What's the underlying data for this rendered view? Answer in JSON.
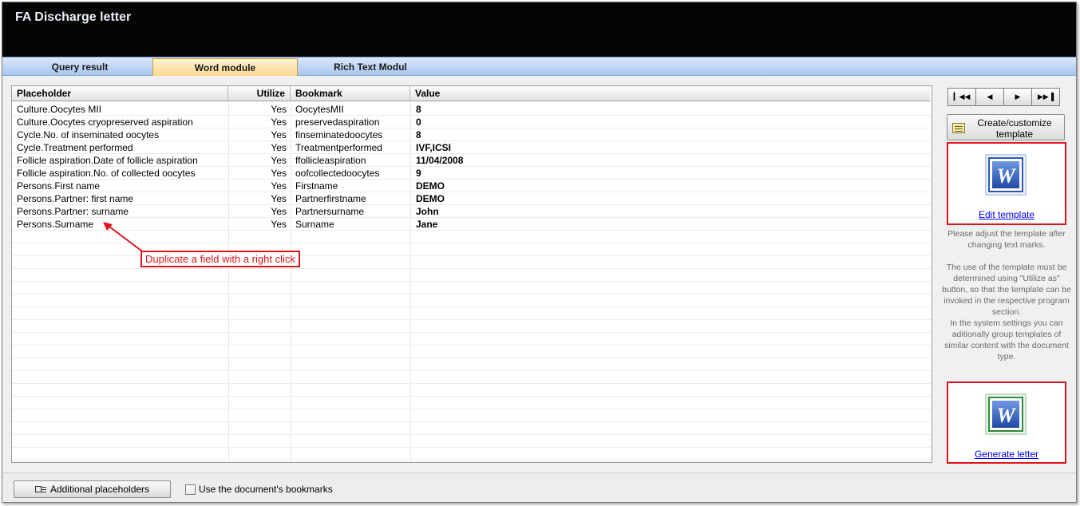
{
  "window": {
    "title": "FA Discharge letter"
  },
  "tabs": [
    {
      "label": "Query result"
    },
    {
      "label": "Word module"
    },
    {
      "label": "Rich Text Modul"
    }
  ],
  "active_tab": "Word module",
  "grid": {
    "columns": [
      "Placeholder",
      "Utilize",
      "Bookmark",
      "Value"
    ],
    "rows": [
      {
        "placeholder": "Culture.Oocytes MII",
        "utilize": "Yes",
        "bookmark": "OocytesMII",
        "value": "8"
      },
      {
        "placeholder": "Culture.Oocytes cryopreserved  aspiration",
        "utilize": "Yes",
        "bookmark": "preservedaspiration",
        "value": "0"
      },
      {
        "placeholder": "Cycle.No. of inseminated oocytes",
        "utilize": "Yes",
        "bookmark": "finseminatedoocytes",
        "value": "8"
      },
      {
        "placeholder": "Cycle.Treatment performed",
        "utilize": "Yes",
        "bookmark": "Treatmentperformed",
        "value": "IVF,ICSI"
      },
      {
        "placeholder": "Follicle aspiration.Date of follicle aspiration",
        "utilize": "Yes",
        "bookmark": "ffollicleaspiration",
        "value": "11/04/2008"
      },
      {
        "placeholder": "Follicle aspiration.No. of collected oocytes",
        "utilize": "Yes",
        "bookmark": "oofcollectedoocytes",
        "value": "9"
      },
      {
        "placeholder": "Persons.First name",
        "utilize": "Yes",
        "bookmark": "Firstname",
        "value": "DEMO"
      },
      {
        "placeholder": "Persons.Partner: first name",
        "utilize": "Yes",
        "bookmark": "Partnerfirstname",
        "value": "DEMO"
      },
      {
        "placeholder": "Persons.Partner: surname",
        "utilize": "Yes",
        "bookmark": "Partnersurname",
        "value": "John"
      },
      {
        "placeholder": "Persons.Surname",
        "utilize": "Yes",
        "bookmark": "Surname",
        "value": "Jane"
      }
    ]
  },
  "annotation": {
    "text": "Duplicate a field with a right click",
    "color": "#e0141a"
  },
  "navigation": {
    "first_icon": "first-record-icon",
    "prev_icon": "previous-record-icon",
    "next_icon": "next-record-icon",
    "last_icon": "last-record-icon"
  },
  "side_panel": {
    "create_button": "Create/customize template",
    "edit_link": "Edit template",
    "help_text": "Please adjust the template after changing text marks.\n\nThe use of the template must be determined using \"Utilize as\" button, so that the template can be invoked in the respective program section.\nIn the system settings you can aditionally group templates of similar content with the document type.",
    "generate_link": "Generate letter",
    "word_icon": "microsoft-word-icon"
  },
  "bottom": {
    "additional_button": "Additional placeholders",
    "bookmarks_checkbox_label": "Use the document's bookmarks",
    "bookmarks_checked": false
  },
  "colors": {
    "titlebar": "#050505",
    "tab_active": "#fbd891",
    "tab_bar": "#a9c6f0",
    "highlight_red": "#e0141a",
    "link": "#0000ee"
  }
}
